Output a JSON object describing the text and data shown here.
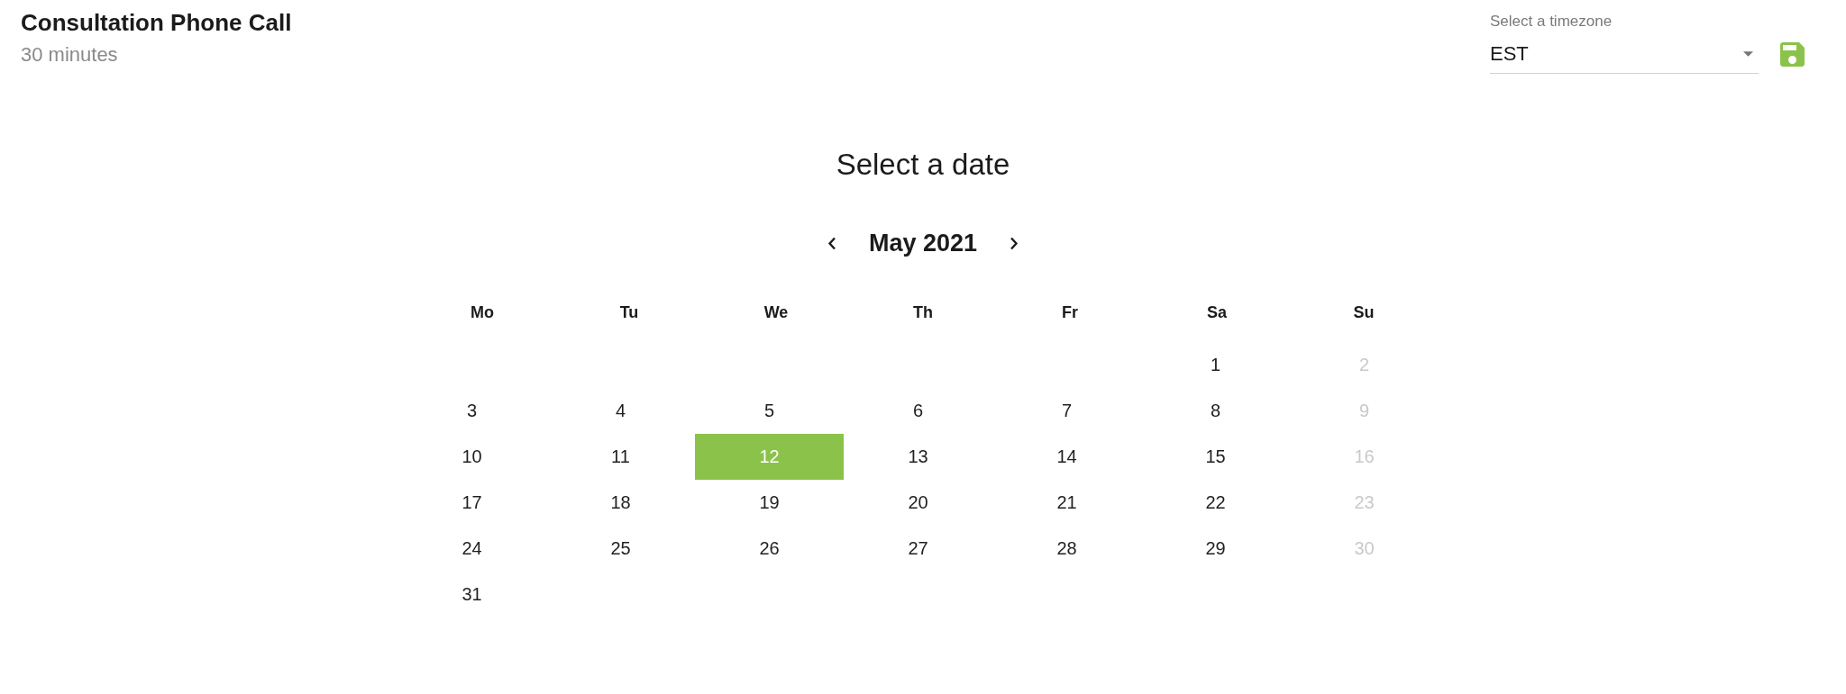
{
  "header": {
    "title": "Consultation Phone Call",
    "duration": "30 minutes"
  },
  "timezone": {
    "label": "Select a timezone",
    "value": "EST"
  },
  "calendar": {
    "heading": "Select a date",
    "month": "May 2021",
    "weekdays": [
      "Mo",
      "Tu",
      "We",
      "Th",
      "Fr",
      "Sa",
      "Su"
    ],
    "weeks": [
      [
        {
          "label": "1",
          "selected": false,
          "disabled": false
        },
        {
          "label": "2",
          "selected": false,
          "disabled": true
        }
      ],
      [
        {
          "label": "3",
          "selected": false,
          "disabled": false
        },
        {
          "label": "4",
          "selected": false,
          "disabled": false
        },
        {
          "label": "5",
          "selected": false,
          "disabled": false
        },
        {
          "label": "6",
          "selected": false,
          "disabled": false
        },
        {
          "label": "7",
          "selected": false,
          "disabled": false
        },
        {
          "label": "8",
          "selected": false,
          "disabled": false
        },
        {
          "label": "9",
          "selected": false,
          "disabled": true
        }
      ],
      [
        {
          "label": "10",
          "selected": false,
          "disabled": false
        },
        {
          "label": "11",
          "selected": false,
          "disabled": false
        },
        {
          "label": "12",
          "selected": true,
          "disabled": false
        },
        {
          "label": "13",
          "selected": false,
          "disabled": false
        },
        {
          "label": "14",
          "selected": false,
          "disabled": false
        },
        {
          "label": "15",
          "selected": false,
          "disabled": false
        },
        {
          "label": "16",
          "selected": false,
          "disabled": true
        }
      ],
      [
        {
          "label": "17",
          "selected": false,
          "disabled": false
        },
        {
          "label": "18",
          "selected": false,
          "disabled": false
        },
        {
          "label": "19",
          "selected": false,
          "disabled": false
        },
        {
          "label": "20",
          "selected": false,
          "disabled": false
        },
        {
          "label": "21",
          "selected": false,
          "disabled": false
        },
        {
          "label": "22",
          "selected": false,
          "disabled": false
        },
        {
          "label": "23",
          "selected": false,
          "disabled": true
        }
      ],
      [
        {
          "label": "24",
          "selected": false,
          "disabled": false
        },
        {
          "label": "25",
          "selected": false,
          "disabled": false
        },
        {
          "label": "26",
          "selected": false,
          "disabled": false
        },
        {
          "label": "27",
          "selected": false,
          "disabled": false
        },
        {
          "label": "28",
          "selected": false,
          "disabled": false
        },
        {
          "label": "29",
          "selected": false,
          "disabled": false
        },
        {
          "label": "30",
          "selected": false,
          "disabled": true
        }
      ],
      [
        {
          "label": "31",
          "selected": false,
          "disabled": false
        }
      ]
    ]
  }
}
